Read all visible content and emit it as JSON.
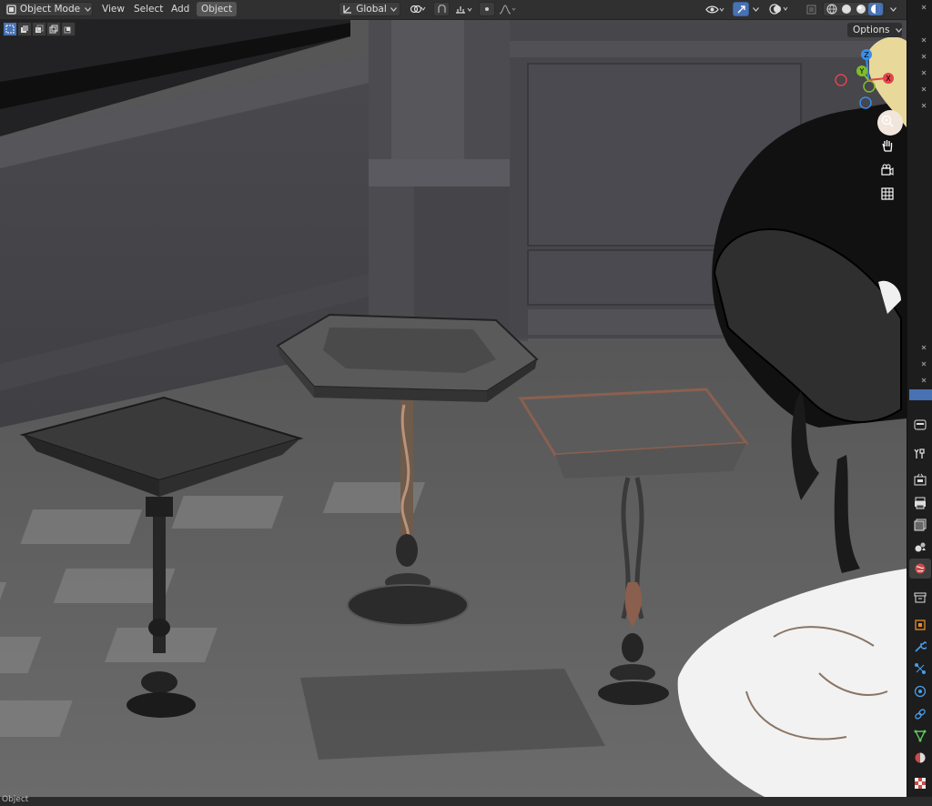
{
  "header": {
    "mode_label": "Object Mode",
    "menus": [
      "View",
      "Select",
      "Add",
      "Object"
    ],
    "active_menu_index": 3,
    "transform_orientation": "Global",
    "icons": [
      "object-mode-icon",
      "transform-orientation-icon",
      "pivot-icon",
      "snap-icon",
      "snap-target-icon",
      "proportional-edit-icon",
      "falloff-icon",
      "visibility-icon",
      "gizmo-icon",
      "overlay-icon",
      "xray-icon",
      "wireframe-shading-icon",
      "solid-shading-icon",
      "material-shading-icon",
      "rendered-shading-icon"
    ]
  },
  "viewport": {
    "options_label": "Options",
    "select_modes": [
      "select-new-icon",
      "select-extend-icon",
      "select-subtract-icon",
      "select-difference-icon",
      "select-intersect-icon"
    ],
    "gizmo_axes": [
      "X",
      "Y",
      "Z"
    ],
    "nav_tools": [
      "zoom-icon",
      "pan-hand-icon",
      "camera-view-icon",
      "orthographic-grid-icon"
    ]
  },
  "properties_tabs": [
    "tool-icon",
    "render-icon",
    "output-icon",
    "view-layer-icon",
    "scene-icon",
    "world-icon",
    "collection-icon",
    "object-icon",
    "modifier-icon",
    "particles-icon",
    "physics-icon",
    "constraints-icon",
    "data-icon",
    "material-icon",
    "texture-icon"
  ],
  "status": {
    "text": "Object"
  },
  "colors": {
    "header_bg": "#303030",
    "accent_blue": "#4772b3",
    "axis_x": "#e5424c",
    "axis_y": "#7fbd2a",
    "axis_z": "#3a8eec"
  }
}
